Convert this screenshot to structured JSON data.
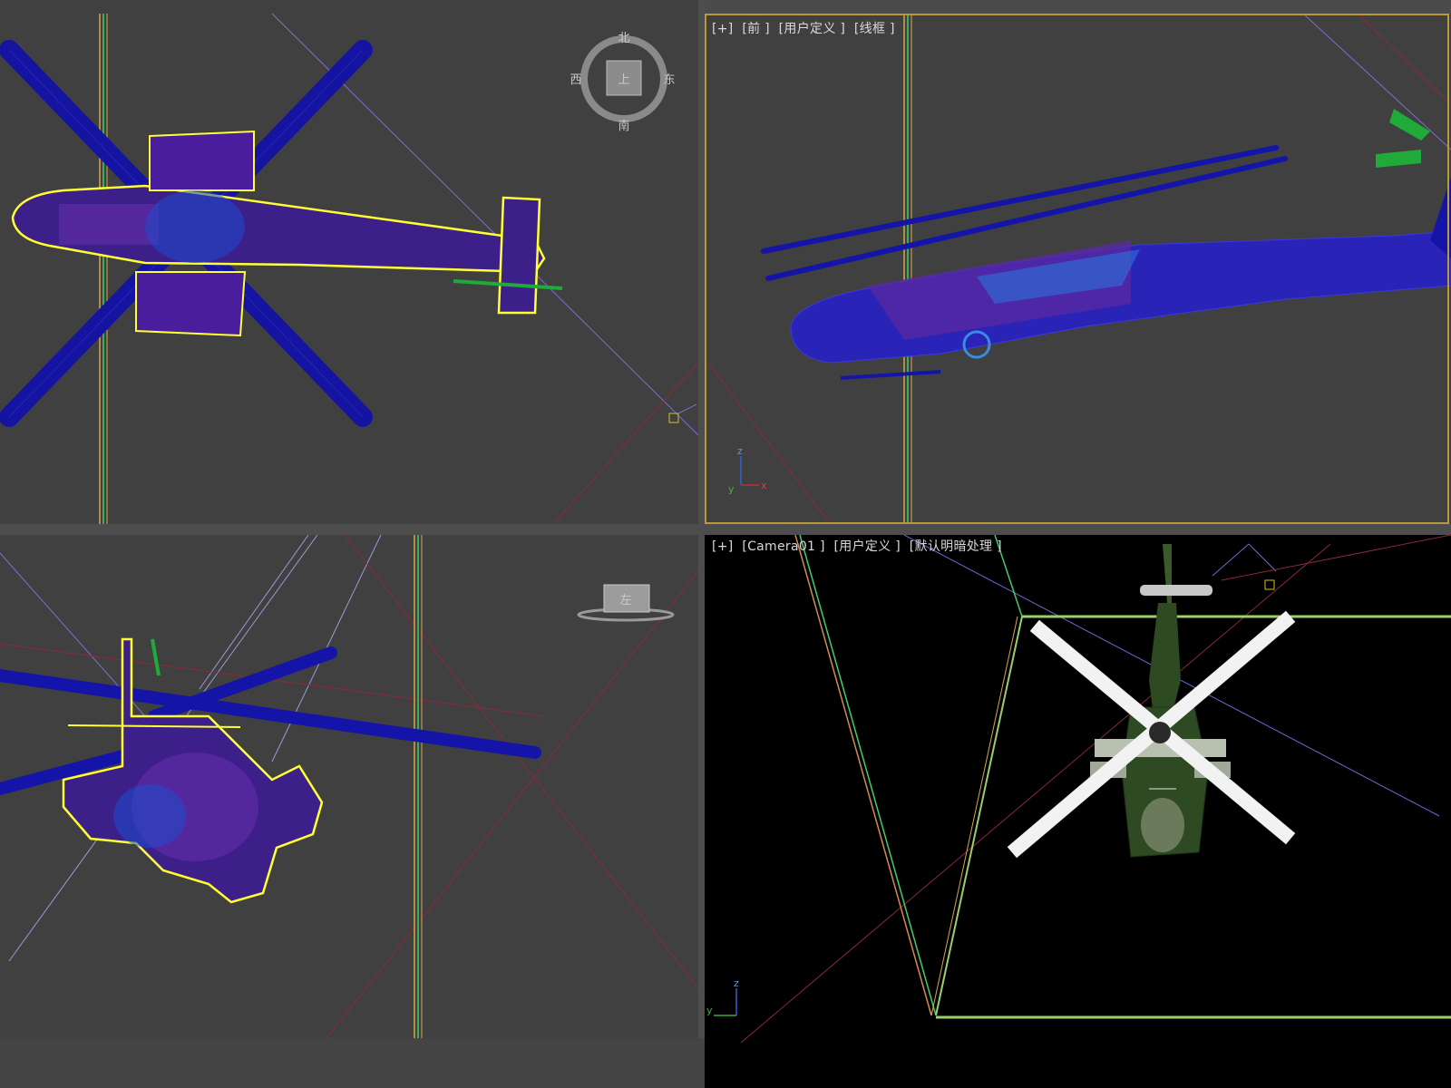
{
  "viewports": {
    "top": {
      "name": "top-viewport",
      "viewcube": {
        "center": "上",
        "north": "北",
        "south": "南",
        "east": "东",
        "west": "西"
      }
    },
    "front": {
      "labels": [
        "[+]",
        "[前 ]",
        "[用户定义 ]",
        "[线框 ]"
      ],
      "axes": {
        "x": "x",
        "y": "y",
        "z": "z"
      }
    },
    "left": {
      "viewcube": {
        "face": "左"
      }
    },
    "camera": {
      "labels": [
        "[+]",
        "[Camera01 ]",
        "[用户定义 ]",
        "[默认明暗处理 ]"
      ],
      "axes": {
        "y": "y",
        "z": "z"
      }
    }
  },
  "colors": {
    "viewport_bg": "#404040",
    "camera_bg": "#000000",
    "active_border": "#b89a3c",
    "wireframe": "#1a1aa8",
    "selection": "#ffff33",
    "helicopter_body": "#2e4a22"
  }
}
